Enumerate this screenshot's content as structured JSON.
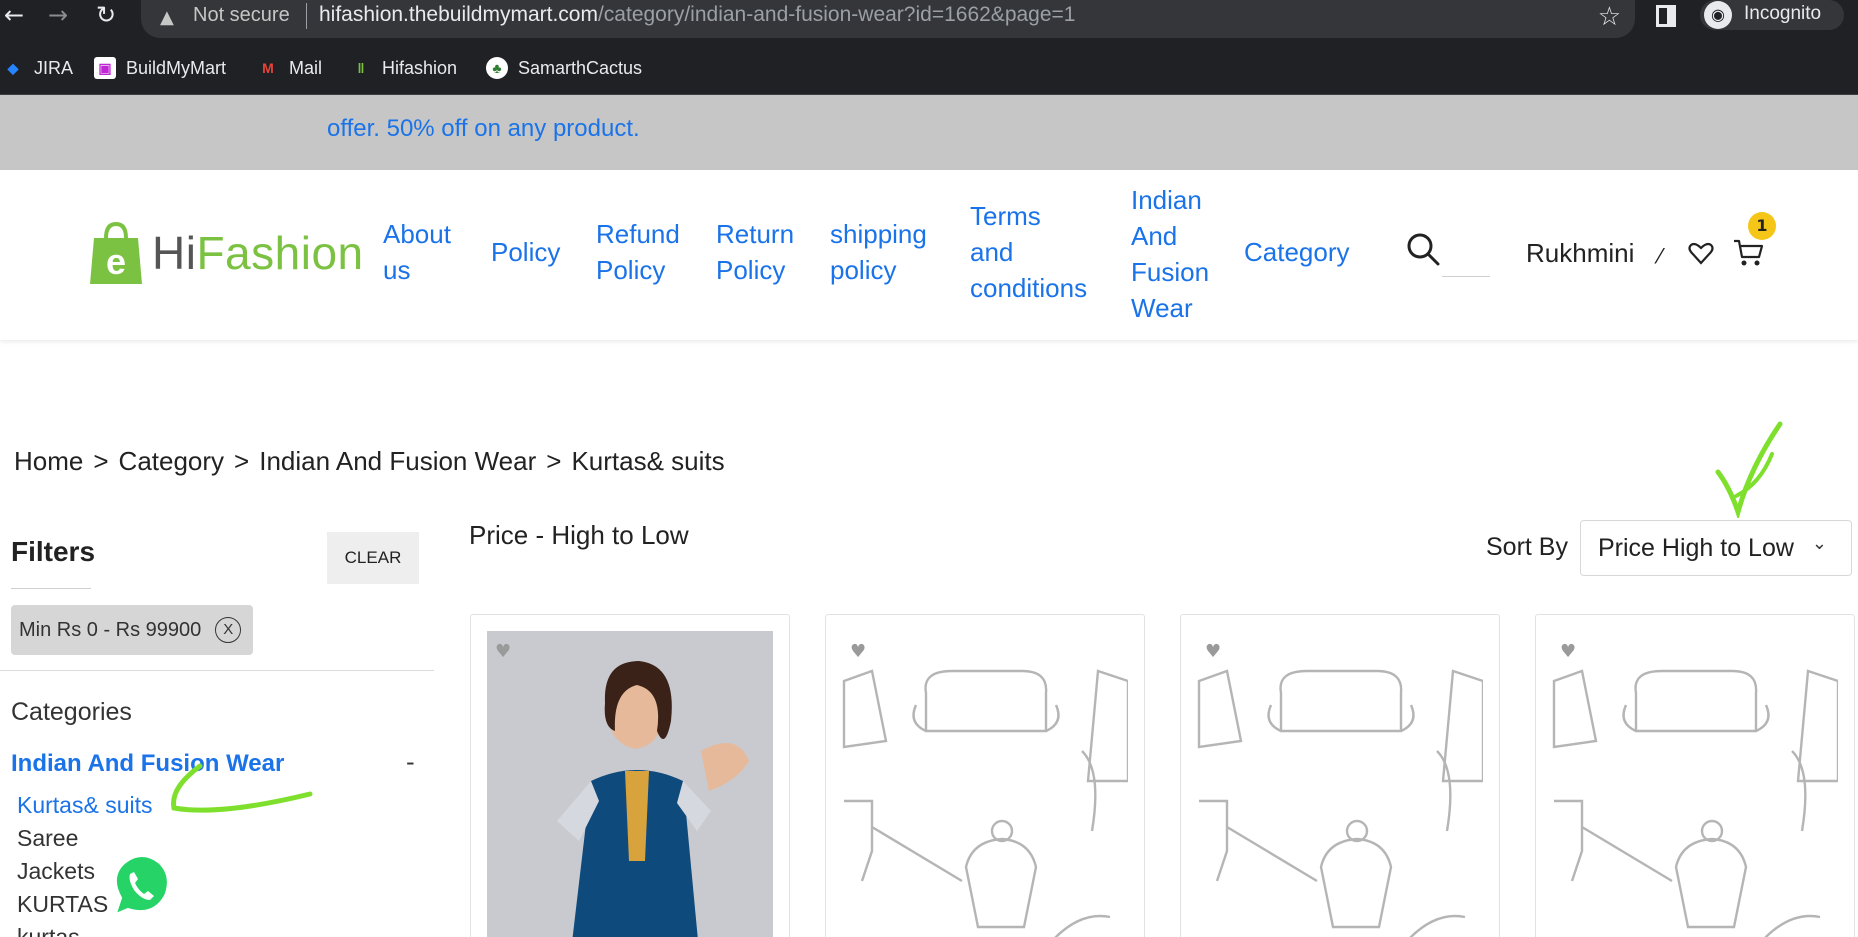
{
  "browser": {
    "security": "Not secure",
    "url_host": "hifashion.thebuildmymart.com",
    "url_path": "/category/indian-and-fusion-wear?id=1662&page=1",
    "incognito_label": "Incognito"
  },
  "bookmarks": [
    {
      "label": "JIRA",
      "icon": "jira-icon"
    },
    {
      "label": "BuildMyMart",
      "icon": "buildmymart-icon"
    },
    {
      "label": "Mail",
      "icon": "gmail-icon"
    },
    {
      "label": "Hifashion",
      "icon": "hifashion-icon"
    },
    {
      "label": "SamarthCactus",
      "icon": "cactus-icon"
    }
  ],
  "offer_banner": "offer. 50% off on any product.",
  "header": {
    "logo_hi": "Hi",
    "logo_fashion": "Fashion",
    "nav": [
      "About\nus",
      "Policy",
      "Refund\nPolicy",
      "Return\nPolicy",
      "shipping\npolicy",
      "Terms\nand\nconditions",
      "Indian\nAnd\nFusion\nWear",
      "Category"
    ],
    "username": "Rukhmini",
    "cart_count": "1"
  },
  "breadcrumb": [
    "Home",
    "Category",
    "Indian And Fusion Wear",
    "Kurtas& suits"
  ],
  "filters": {
    "title": "Filters",
    "clear_label": "CLEAR",
    "chip_label": "Min Rs 0 - Rs 99900",
    "chip_close": "X",
    "categories_heading": "Categories",
    "parent_category": "Indian And Fusion Wear",
    "parent_toggle": "-",
    "subcategories": [
      "Kurtas& suits",
      "Saree",
      "Jackets",
      "KURTAS",
      "kurtas"
    ]
  },
  "listing": {
    "sort_title": "Price - High to Low",
    "sort_by_label": "Sort By",
    "sort_selected": "Price High to Low"
  },
  "colors": {
    "link_blue": "#1a73e8",
    "brand_green": "#7cc242",
    "annotation_green": "#7ee02c",
    "badge_yellow": "#f5c518"
  }
}
